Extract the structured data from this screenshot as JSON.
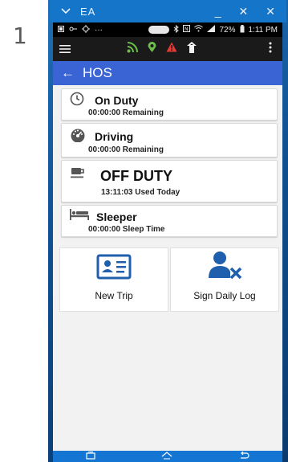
{
  "page_number": "1",
  "window": {
    "title": "EA",
    "controls": {
      "minimize": "_",
      "restore": "✕",
      "close": "✕"
    }
  },
  "status_bar": {
    "left_dots": "···",
    "battery_percent": "72%",
    "time": "1:11 PM"
  },
  "appbar": {
    "back": "←",
    "title": "HOS"
  },
  "cards": [
    {
      "title": "On Duty",
      "sub": "00:00:00 Remaining",
      "icon": "clock-icon"
    },
    {
      "title": "Driving",
      "sub": "00:00:00 Remaining",
      "icon": "speedometer-icon"
    },
    {
      "title": "OFF DUTY",
      "sub": "13:11:03 Used Today",
      "icon": "coffee-cup-icon"
    },
    {
      "title": "Sleeper",
      "sub": "00:00:00 Sleep Time",
      "icon": "bed-icon"
    }
  ],
  "actions": {
    "new_trip": "New Trip",
    "sign_daily_log": "Sign Daily Log"
  },
  "colors": {
    "accent_blue": "#3a63d4",
    "toolbar_green": "#6cc04a",
    "toolbar_red": "#e53935",
    "icon_blue": "#1f5fae"
  }
}
